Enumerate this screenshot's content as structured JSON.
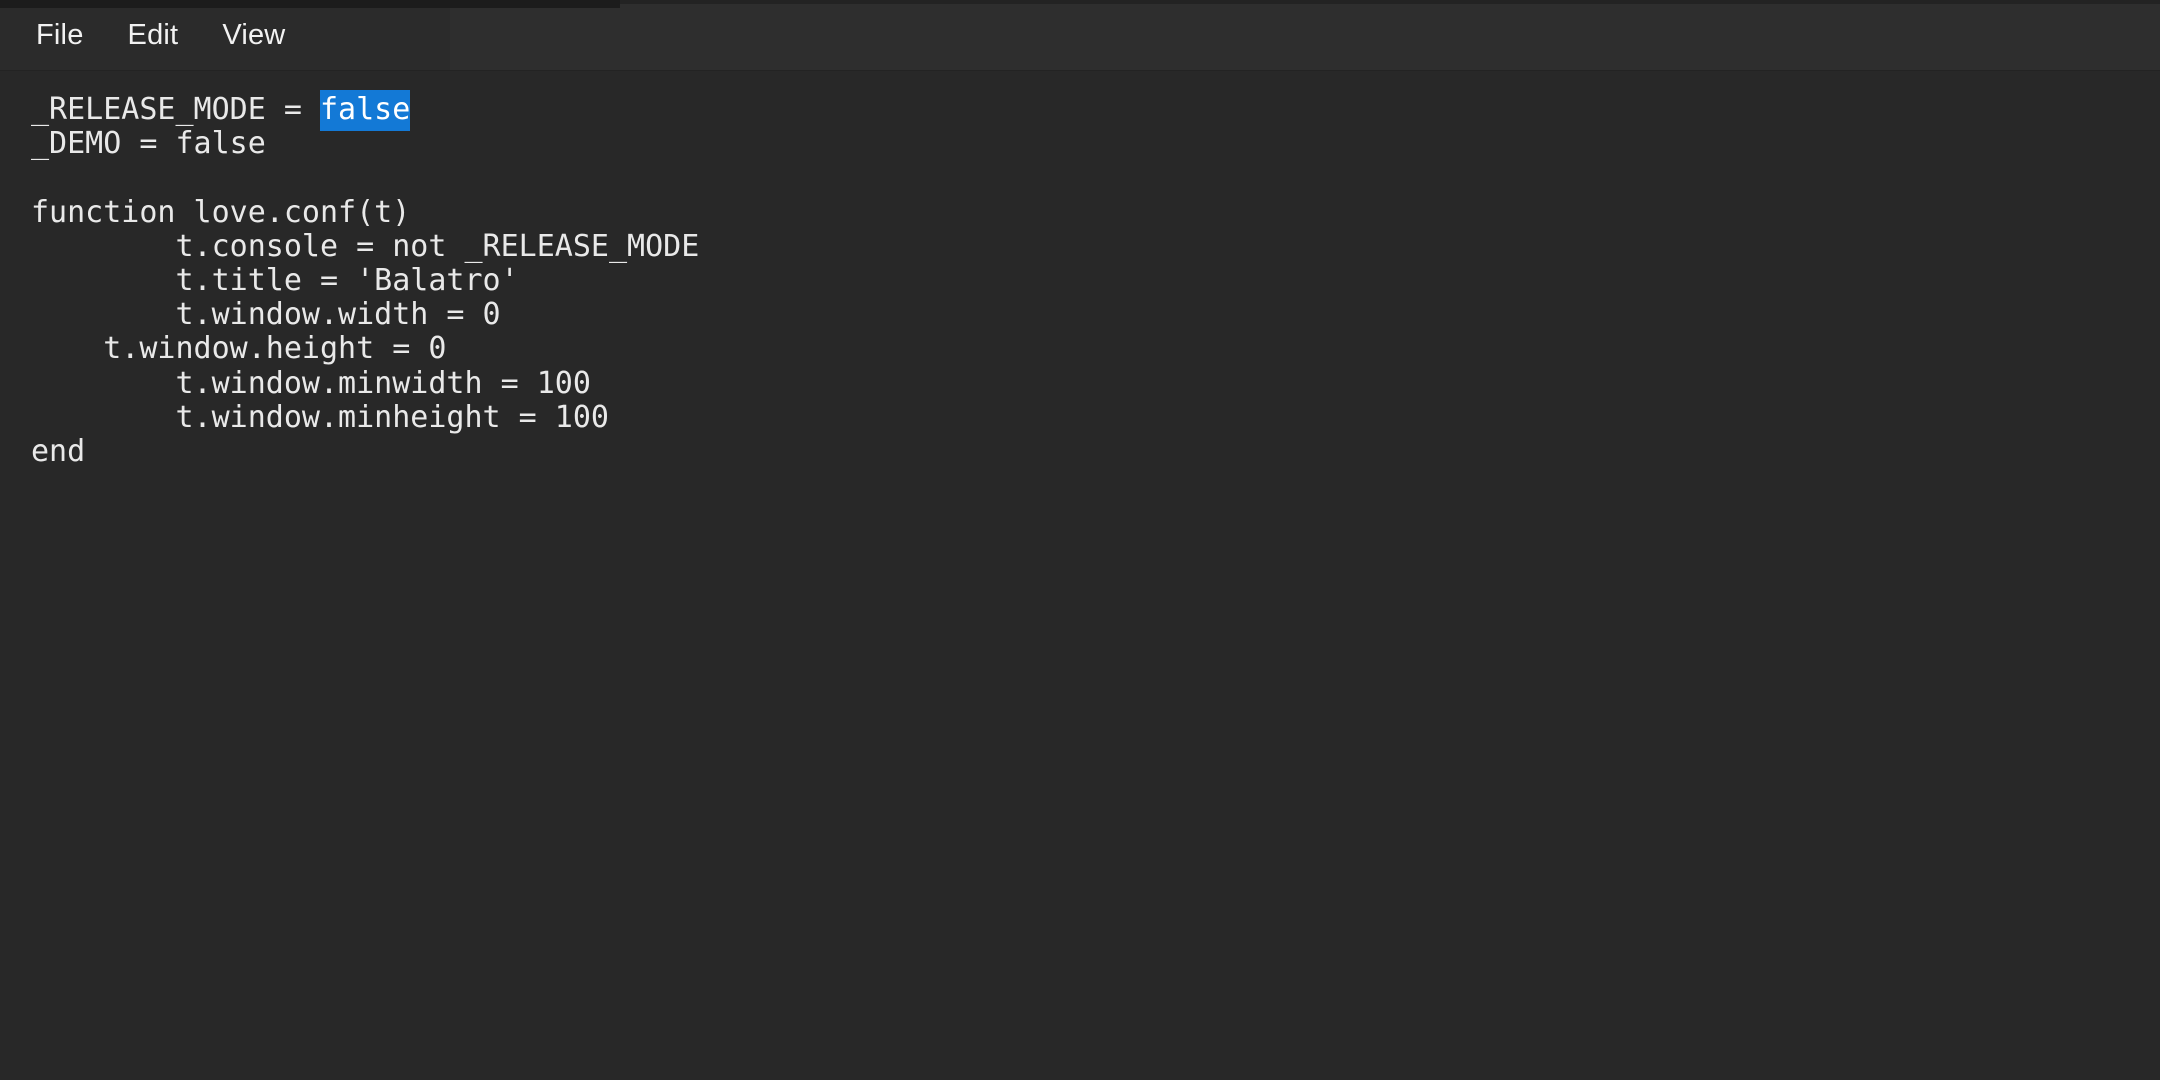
{
  "window": {
    "background_color": "#282828",
    "menubar_color": "#2b2b2b",
    "text_color": "#e9e9e9",
    "selection_color": "#1379d6",
    "selection_text_color": "#ffffff"
  },
  "menubar": {
    "items": [
      {
        "label": "File",
        "name": "menu-file"
      },
      {
        "label": "Edit",
        "name": "menu-edit"
      },
      {
        "label": "View",
        "name": "menu-view"
      }
    ]
  },
  "editor": {
    "language": "lua",
    "selected_text": "false",
    "lines": [
      {
        "indent": "",
        "before": "_RELEASE_MODE = ",
        "selected": "false",
        "after": ""
      },
      {
        "indent": "",
        "before": "_DEMO = false",
        "selected": "",
        "after": ""
      },
      {
        "indent": "",
        "before": "",
        "selected": "",
        "after": ""
      },
      {
        "indent": "",
        "before": "function love.conf(t)",
        "selected": "",
        "after": ""
      },
      {
        "indent": "        ",
        "before": "t.console = not _RELEASE_MODE",
        "selected": "",
        "after": ""
      },
      {
        "indent": "        ",
        "before": "t.title = 'Balatro'",
        "selected": "",
        "after": ""
      },
      {
        "indent": "        ",
        "before": "t.window.width = 0",
        "selected": "",
        "after": ""
      },
      {
        "indent": "    ",
        "before": "t.window.height = 0",
        "selected": "",
        "after": ""
      },
      {
        "indent": "        ",
        "before": "t.window.minwidth = 100",
        "selected": "",
        "after": ""
      },
      {
        "indent": "        ",
        "before": "t.window.minheight = 100",
        "selected": "",
        "after": ""
      },
      {
        "indent": "",
        "before": "end",
        "selected": "",
        "after": ""
      }
    ]
  }
}
